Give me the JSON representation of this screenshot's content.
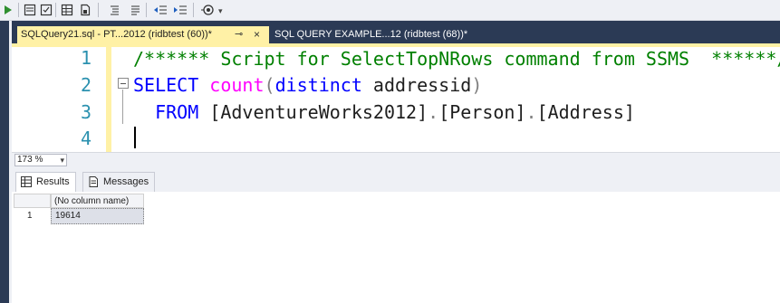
{
  "tabs": {
    "active": "SQLQuery21.sql - PT...2012 (ridbtest (60))*",
    "inactive": "SQL QUERY EXAMPLE...12 (ridbtest (68))*"
  },
  "editor": {
    "line_numbers": [
      "1",
      "2",
      "3",
      "4"
    ],
    "line1": {
      "comment": "/****** Script for SelectTopNRows command from SSMS  ******/"
    },
    "line2": {
      "select": "SELECT",
      "count": "count",
      "lparen": "(",
      "distinct": "distinct",
      "col": " addressid",
      "rparen": ")"
    },
    "line3": {
      "from": "FROM",
      "db": "[AdventureWorks2012]",
      "dot1": ".",
      "schema": "[Person]",
      "dot2": ".",
      "table": "[Address]"
    }
  },
  "zoom": {
    "value": "173 %"
  },
  "results": {
    "tab_results": "Results",
    "tab_messages": "Messages",
    "column_header": "(No column name)",
    "row_number": "1",
    "value": "19614"
  },
  "colors": {
    "tab_active_bg": "#fff1a6",
    "tabbar_bg": "#2b3a55",
    "keyword": "#0000ff",
    "function": "#ff00ff",
    "comment": "#008000",
    "line_number": "#2b91af"
  }
}
